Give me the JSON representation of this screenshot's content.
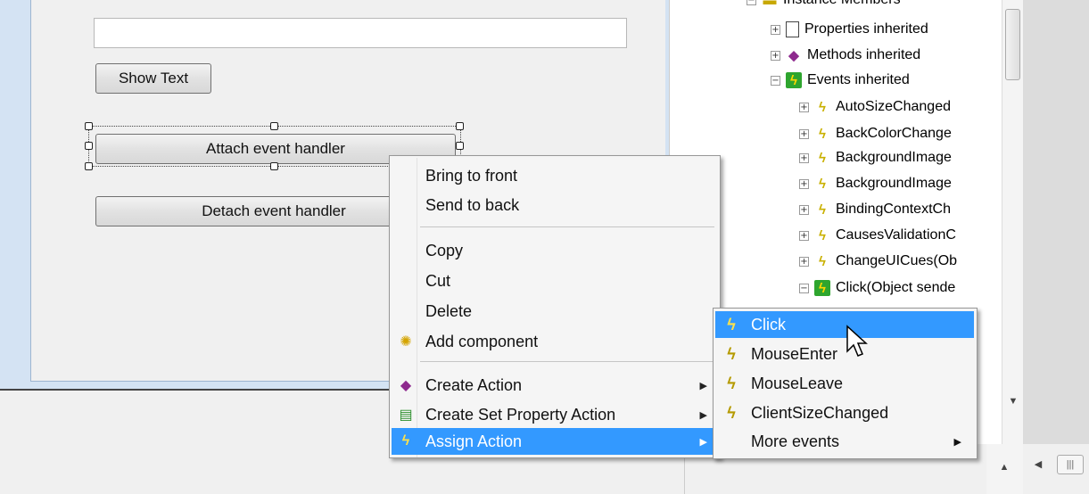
{
  "designer": {
    "textbox_value": "",
    "show_text_label": "Show Text",
    "attach_label": "Attach event handler",
    "detach_label": "Detach event handler"
  },
  "tree": {
    "rows": [
      {
        "label": "Instance Members",
        "icon": "folder-icon",
        "expander": "−"
      },
      {
        "label": "Properties inherited",
        "icon": "properties-icon",
        "expander": "+"
      },
      {
        "label": "Methods inherited",
        "icon": "method-icon",
        "expander": "+"
      },
      {
        "label": "Events inherited",
        "icon": "events-icon",
        "expander": "−"
      },
      {
        "label": "AutoSizeChanged",
        "icon": "lightning-icon",
        "expander": "+"
      },
      {
        "label": "BackColorChange",
        "icon": "lightning-icon",
        "expander": "+"
      },
      {
        "label": "BackgroundImage",
        "icon": "lightning-icon",
        "expander": "+"
      },
      {
        "label": "BackgroundImage",
        "icon": "lightning-icon",
        "expander": "+"
      },
      {
        "label": "BindingContextCh",
        "icon": "lightning-icon",
        "expander": "+"
      },
      {
        "label": "CausesValidationC",
        "icon": "lightning-icon",
        "expander": "+"
      },
      {
        "label": "ChangeUICues(Ob",
        "icon": "lightning-icon",
        "expander": "+"
      },
      {
        "label": "Click(Object sende",
        "icon": "event-handler-icon",
        "expander": "−"
      }
    ]
  },
  "context_menu": {
    "items": [
      {
        "label": "Bring to front",
        "icon": ""
      },
      {
        "label": "Send to back",
        "icon": ""
      },
      {
        "label": "Copy",
        "icon": ""
      },
      {
        "label": "Cut",
        "icon": ""
      },
      {
        "label": "Delete",
        "icon": ""
      },
      {
        "label": "Add component",
        "icon": "lightbulb-icon"
      },
      {
        "label": "Create Action",
        "icon": "create-action-icon"
      },
      {
        "label": "Create Set Property Action",
        "icon": "set-property-icon"
      },
      {
        "label": "Assign Action",
        "icon": "lightning-icon"
      }
    ],
    "submenu_arrow": "▶"
  },
  "sub_menu": {
    "items": [
      {
        "label": "Click",
        "icon": "lightning-icon"
      },
      {
        "label": "MouseEnter",
        "icon": "lightning-icon"
      },
      {
        "label": "MouseLeave",
        "icon": "lightning-icon"
      },
      {
        "label": "ClientSizeChanged",
        "icon": "lightning-icon"
      },
      {
        "label": "More events",
        "icon": ""
      }
    ]
  },
  "colors": {
    "highlight": "#3399ff",
    "menu_bg": "#f5f5f5",
    "lightning": "#c9b000"
  }
}
